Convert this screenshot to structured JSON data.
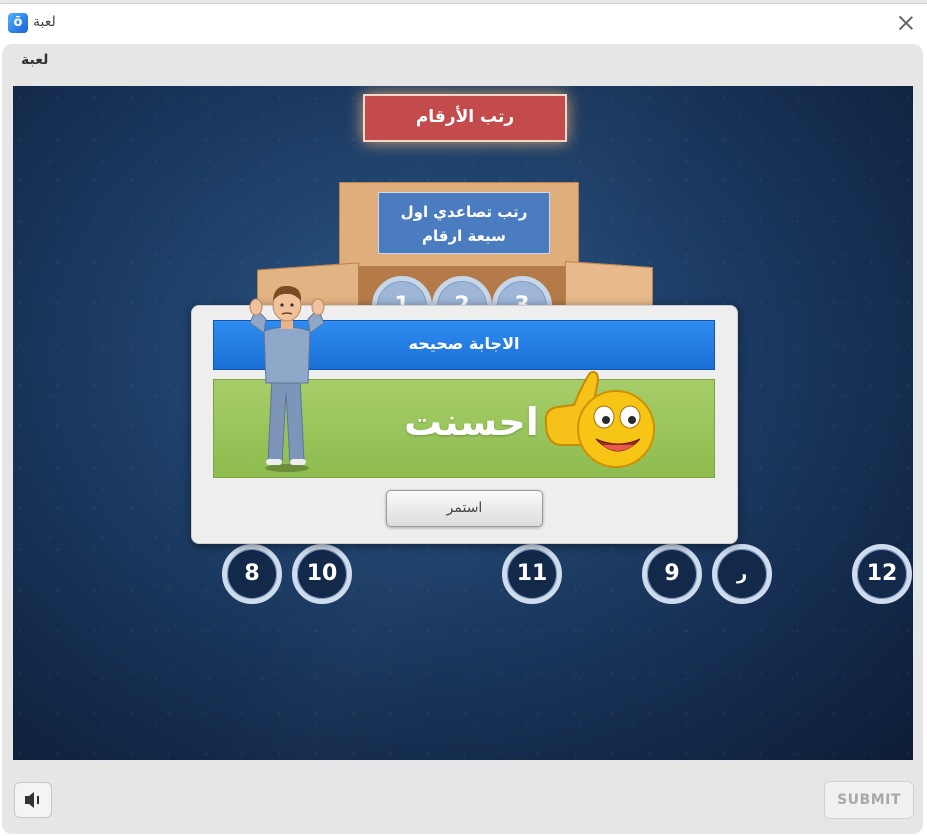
{
  "window": {
    "title": "لعبة",
    "app_icon_glyph": "ō"
  },
  "frame": {
    "title": "لعبة"
  },
  "game": {
    "title": "رتب الأرقام",
    "instruction_line1": "رتب تصاعدي اول",
    "instruction_line2": "سبعة ارقام",
    "box_numbers": [
      "1",
      "2",
      "3"
    ],
    "tiles": [
      "8",
      "10",
      "11",
      "9",
      "ر",
      "12"
    ]
  },
  "feedback": {
    "header": "الاجابة صحيحه",
    "praise": "احسنت",
    "continue_label": "استمر"
  },
  "controls": {
    "submit_label": "SUBMIT",
    "speaker_icon": "speaker-icon"
  },
  "colors": {
    "title_red": "#c44b4b",
    "popup_blue": "#1a6fd7",
    "praise_green": "#8ebc4f",
    "board": "#1f416b"
  }
}
